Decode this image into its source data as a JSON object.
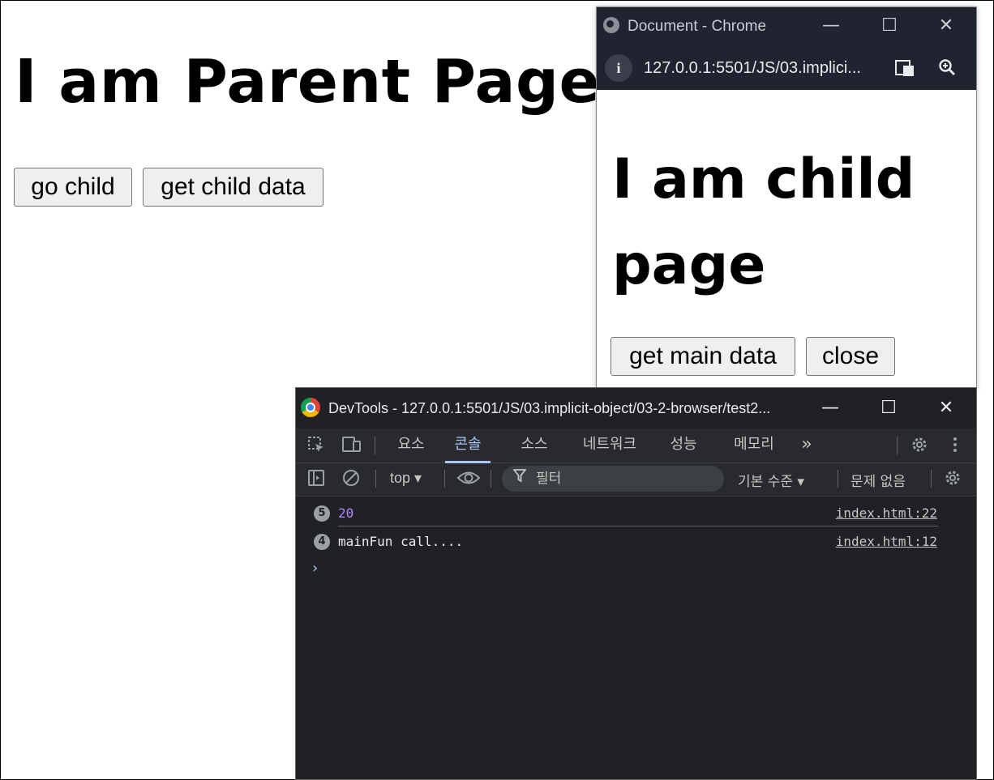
{
  "parent": {
    "heading": "I am Parent Page!!",
    "buttons": {
      "go_child": "go child",
      "get_child_data": "get child data"
    }
  },
  "child_window": {
    "title": "Document - Chrome",
    "url": "127.0.0.1:5501/JS/03.implici...",
    "heading": "I am child page",
    "buttons": {
      "get_main_data": "get main data",
      "close": "close"
    }
  },
  "devtools": {
    "title": "DevTools - 127.0.0.1:5501/JS/03.implicit-object/03-2-browser/test2...",
    "tabs": [
      {
        "label": "요소",
        "active": false
      },
      {
        "label": "콘솔",
        "active": true
      },
      {
        "label": "소스",
        "active": false
      },
      {
        "label": "네트워크",
        "active": false
      },
      {
        "label": "성능",
        "active": false
      },
      {
        "label": "메모리",
        "active": false
      }
    ],
    "more_tabs": "»",
    "context": "top ▾",
    "filter_placeholder": "필터",
    "levels": "기본 수준 ▾",
    "issues": "문제 없음",
    "logs": [
      {
        "count": "5",
        "message": "20",
        "source": "index.html:22",
        "color": "#b388ff"
      },
      {
        "count": "4",
        "message": "mainFun call....",
        "source": "index.html:12",
        "color": "#e8eaed"
      }
    ],
    "prompt": "›"
  },
  "window_controls": {
    "minimize": "—",
    "maximize": "☐",
    "close": "✕"
  },
  "colors": {
    "devtools_bg": "#202124",
    "accent": "#a8c7fa",
    "number": "#b388ff"
  }
}
